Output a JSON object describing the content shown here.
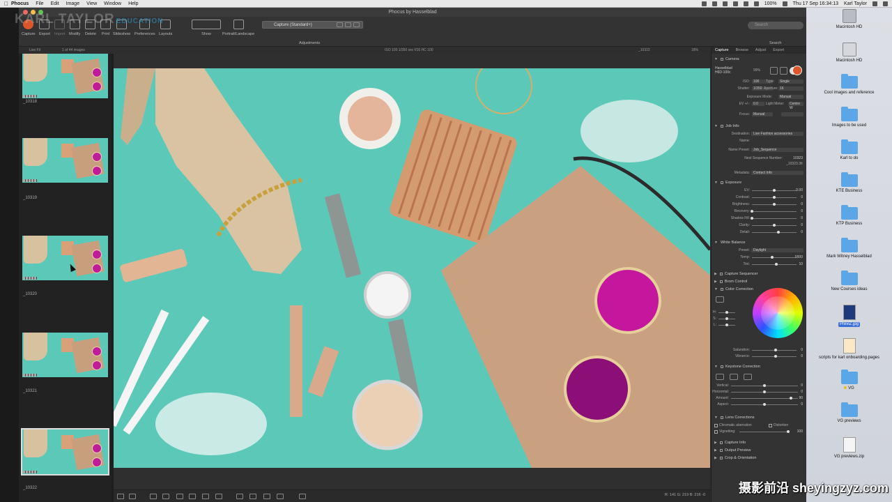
{
  "menubar": {
    "items": [
      "Phocus",
      "File",
      "Edit",
      "Image",
      "View",
      "Window",
      "Help"
    ],
    "battery": "100%",
    "datetime": "Thu 17 Sep  16:34:13",
    "user": "Karl Taylor"
  },
  "window": {
    "title": "Phocus by Hasselblad"
  },
  "branding": {
    "logo_text": "KARL TAYLOR",
    "logo_sub": "EDUCATION",
    "watermark": "摄影前沿 sheyingzyz.com"
  },
  "toolbar": {
    "items": [
      "Capture",
      "Export",
      "Import",
      "Modify",
      "Delete",
      "Print",
      "Slideshow",
      "Preferences",
      "Layouts",
      "Show",
      "Portrait/Landscape"
    ],
    "preset": "Capture (Standard+)",
    "adjustments_label": "Adjustments",
    "search_placeholder": "Search",
    "search_label": "Search"
  },
  "subbar": {
    "left": "Live Fil",
    "count": "1 of 44 images",
    "meta": "ISO 100  1/350 sec  f/16  HC 100",
    "file": "_10322",
    "zoom": "18%"
  },
  "filmstrip": {
    "items": [
      {
        "label": "_10318"
      },
      {
        "label": "_10319"
      },
      {
        "label": "_10320"
      },
      {
        "label": "_10321"
      },
      {
        "label": "_10322"
      }
    ]
  },
  "viewer": {
    "rgb_readout": "R: 141  G: 219  B: 216  -0"
  },
  "panel": {
    "tabs": [
      "Capture",
      "Browse",
      "Adjust",
      "Export"
    ],
    "camera": {
      "title": "Camera",
      "model": "Hasselblad H6D-100c",
      "battery": "99%",
      "iso_label": "ISO:",
      "iso": "100",
      "type_label": "Type:",
      "type": "Single",
      "shutter_label": "Shutter:",
      "shutter": "1/350",
      "aperture_label": "Aperture:",
      "aperture": "16",
      "exposure_mode_label": "Exposure Mode:",
      "exposure_mode": "Manual",
      "ev_label": "EV +/-:",
      "ev": "0.0",
      "light_meter_label": "Light Meter:",
      "light_meter": "Centre W",
      "focus_label": "Focus:",
      "focus": "Manual"
    },
    "job": {
      "title": "Job Info",
      "destination_label": "Destination:",
      "destination": "Live Fashion accessories",
      "name_label": "Name:",
      "preset_label": "Name Preset:",
      "preset": "Job_Sequence",
      "nsn_label": "Next Sequence Number:",
      "nsn": "10323",
      "nsn_sub": "_10323.3fr",
      "metadata_label": "Metadata:",
      "metadata": "Contact Info"
    },
    "exposure": {
      "title": "Exposure",
      "sliders": [
        {
          "label": "EV:",
          "value": "0.00",
          "pos": 0.5
        },
        {
          "label": "Contrast:",
          "value": "0",
          "pos": 0.5
        },
        {
          "label": "Brightness:",
          "value": "0",
          "pos": 0.5
        },
        {
          "label": "Recovery:",
          "value": "0",
          "pos": 0.0
        },
        {
          "label": "Shadow Fill:",
          "value": "0",
          "pos": 0.0
        },
        {
          "label": "Clarity:",
          "value": "0",
          "pos": 0.5
        },
        {
          "label": "Detail:",
          "value": "0",
          "pos": 0.6
        }
      ]
    },
    "wb": {
      "title": "White Balance",
      "preset_label": "Preset:",
      "preset": "Daylight",
      "temp_label": "Temp:",
      "temp": "5500",
      "temp_pos": 0.45,
      "tint_label": "Tint:",
      "tint": "10",
      "tint_pos": 0.55
    },
    "collapsed_sections": [
      "Capture Sequencer",
      "Brom Control"
    ],
    "color_correction": {
      "title": "Color Correction",
      "hsl": [
        {
          "label": "H:"
        },
        {
          "label": "S:"
        },
        {
          "label": "L:"
        }
      ],
      "saturation_label": "Saturation:",
      "saturation": "0",
      "vibrance_label": "Vibrance:",
      "vibrance": "0"
    },
    "keystone": {
      "title": "Keystone Correction",
      "sliders": [
        {
          "label": "Vertical:",
          "value": "0",
          "pos": 0.5
        },
        {
          "label": "Horizontal:",
          "value": "0",
          "pos": 0.5
        },
        {
          "label": "Amount:",
          "value": "90",
          "pos": 0.9
        },
        {
          "label": "Aspect:",
          "value": "0",
          "pos": 0.5
        }
      ]
    },
    "lens": {
      "title": "Lens Corrections",
      "chromatic_label": "Chromatic aberration",
      "distortion_label": "Distortion",
      "vignetting_label": "Vignetting:",
      "vignetting": "100"
    },
    "bottom_sections": [
      "Capture Info",
      "Output Preview",
      "Crop & Orientation"
    ]
  },
  "desktop": {
    "items": [
      {
        "name": "Macintosh HD",
        "kind": "hd"
      },
      {
        "name": "Macintosh HD",
        "kind": "net"
      },
      {
        "name": "Cool images and reference",
        "kind": "folder"
      },
      {
        "name": "Images to be used",
        "kind": "folder"
      },
      {
        "name": "Karl to do",
        "kind": "folder"
      },
      {
        "name": "KTE Business",
        "kind": "folder"
      },
      {
        "name": "KTP Business",
        "kind": "folder"
      },
      {
        "name": "Mark Witney Hasselblad",
        "kind": "folder"
      },
      {
        "name": "New Courses ideas",
        "kind": "folder"
      },
      {
        "name": "PreviZ.jpg",
        "kind": "ps"
      },
      {
        "name": "scripts for karl onboarding.pages",
        "kind": "pg"
      },
      {
        "name": "VG",
        "kind": "folder"
      },
      {
        "name": "VG previews",
        "kind": "folder"
      },
      {
        "name": "VG previews.zip",
        "kind": "zip"
      }
    ]
  },
  "colors": {
    "accent": "#d9572b",
    "photo_bg": "#5cc9b8",
    "folder": "#5aa6e6"
  }
}
